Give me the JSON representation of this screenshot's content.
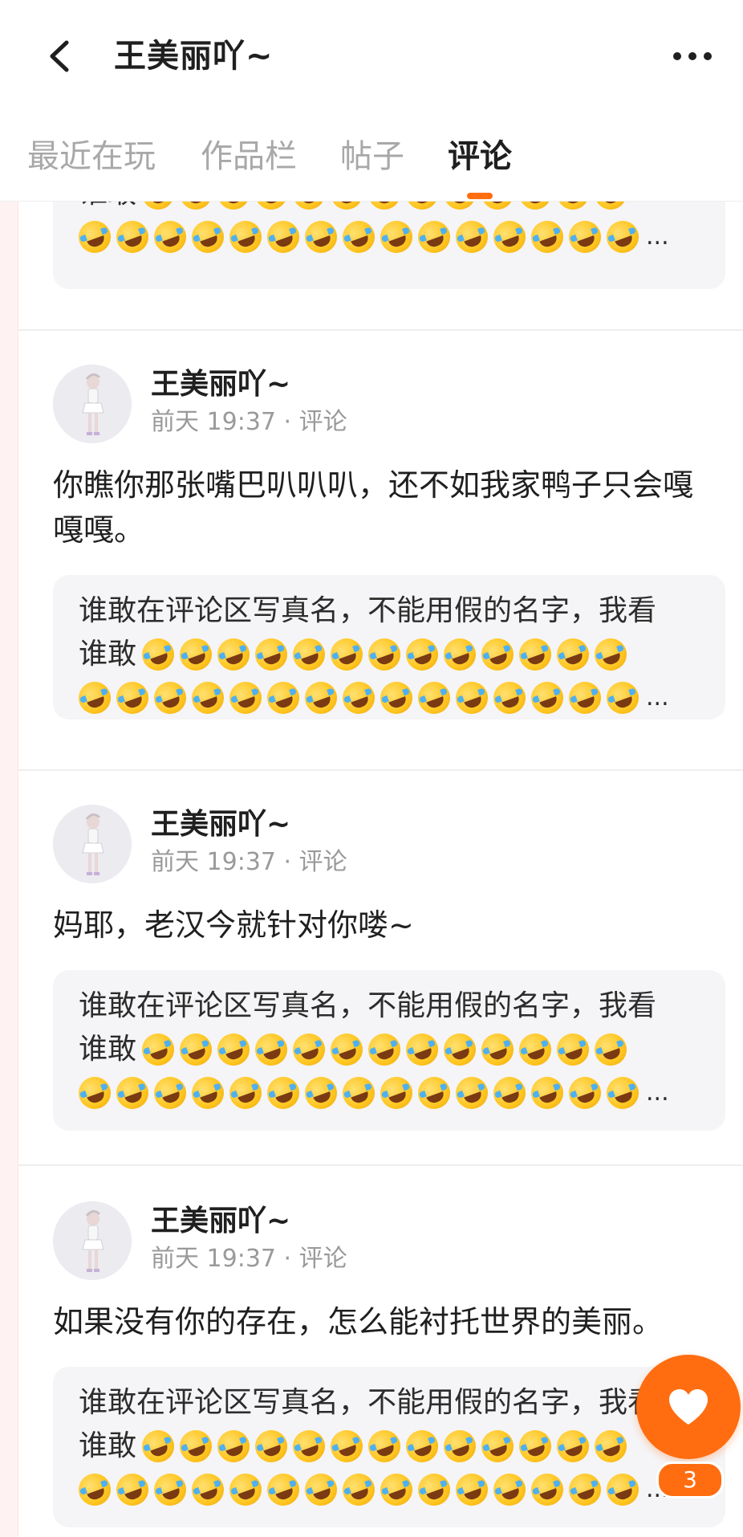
{
  "header": {
    "title": "王美丽吖~"
  },
  "tabs": [
    {
      "label": "最近在玩",
      "active": false
    },
    {
      "label": "作品栏",
      "active": false
    },
    {
      "label": "帖子",
      "active": false
    },
    {
      "label": "评论",
      "active": true
    }
  ],
  "accent_color": "#ff6d10",
  "quote": {
    "line1": "谁敢在评论区写真名，不能用假的名字，我看",
    "lead": "谁敢",
    "emoji": "rolling-on-floor-laughing",
    "ellipsis": "..."
  },
  "posts": [
    {
      "author": "王美丽吖~",
      "meta": "前天 19:37 · 评论",
      "text": "你瞧你那张嘴巴叭叭叭，还不如我家鸭子只会嘎嘎嘎。"
    },
    {
      "author": "王美丽吖~",
      "meta": "前天 19:37 · 评论",
      "text": "妈耶，老汉今就针对你喽~"
    },
    {
      "author": "王美丽吖~",
      "meta": "前天 19:37 · 评论",
      "text": "如果没有你的存在，怎么能衬托世界的美丽。"
    }
  ],
  "like": {
    "count": "3"
  }
}
